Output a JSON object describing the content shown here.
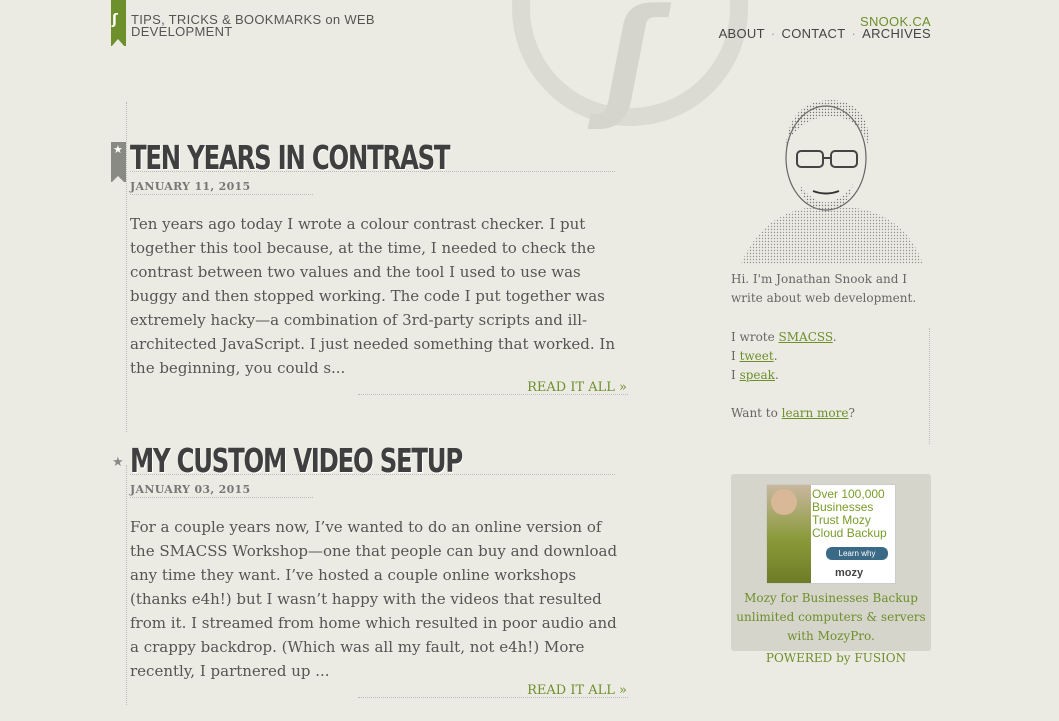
{
  "header": {
    "tagline": "TIPS, TRICKS & BOOKMARKS on WEB DEVELOPMENT",
    "site_name": "SNOOK.CA",
    "nav": [
      {
        "label": "ABOUT"
      },
      {
        "label": "CONTACT"
      },
      {
        "label": "ARCHIVES"
      }
    ]
  },
  "posts": [
    {
      "title": "TEN YEARS IN CONTRAST",
      "date": "JANUARY 11, 2015",
      "excerpt": "Ten years ago today I wrote a colour contrast checker. I put together this tool because, at the time, I needed to check the contrast between two values and the tool I used to use was buggy and then stopped working. The code I put together was extremely hacky—a combination of 3rd-party scripts and ill-architected JavaScript. I just needed something that worked. In the beginning, you could s...",
      "read_more": "READ IT ALL »"
    },
    {
      "title": "MY CUSTOM VIDEO SETUP",
      "date": "JANUARY 03, 2015",
      "excerpt": "For a couple years now, I’ve wanted to do an online version of the SMACSS Workshop—one that people can buy and download any time they want. I’ve hosted a couple online workshops (thanks e4h!) but I wasn’t happy with the videos that resulted from it. I streamed from home which resulted in poor audio and a crappy backdrop. (Which was all my fault, not e4h!) More recently, I partnered up ...",
      "read_more": "READ IT ALL »"
    }
  ],
  "sidebar": {
    "intro": "Hi. I'm Jonathan Snook and I write about web development.",
    "line1_prefix": "I wrote ",
    "line1_link": "SMACSS",
    "line1_suffix": ".",
    "line2_prefix": "I ",
    "line2_link": "tweet",
    "line2_suffix": ".",
    "line3_prefix": "I ",
    "line3_link": "speak",
    "line3_suffix": ".",
    "line4_prefix": "Want to ",
    "line4_link": "learn more",
    "line4_suffix": "?"
  },
  "ad": {
    "banner_text": "Over 100,000 Businesses Trust Mozy Cloud Backup",
    "banner_button": "Learn why",
    "banner_logo": "mozy",
    "copy": "Mozy for Businesses Backup unlimited computers & servers with MozyPro.",
    "powered": "POWERED by FUSION"
  },
  "colors": {
    "background": "#ecebe3",
    "accent": "#6d8f2c",
    "heading": "#3f3f3f"
  }
}
